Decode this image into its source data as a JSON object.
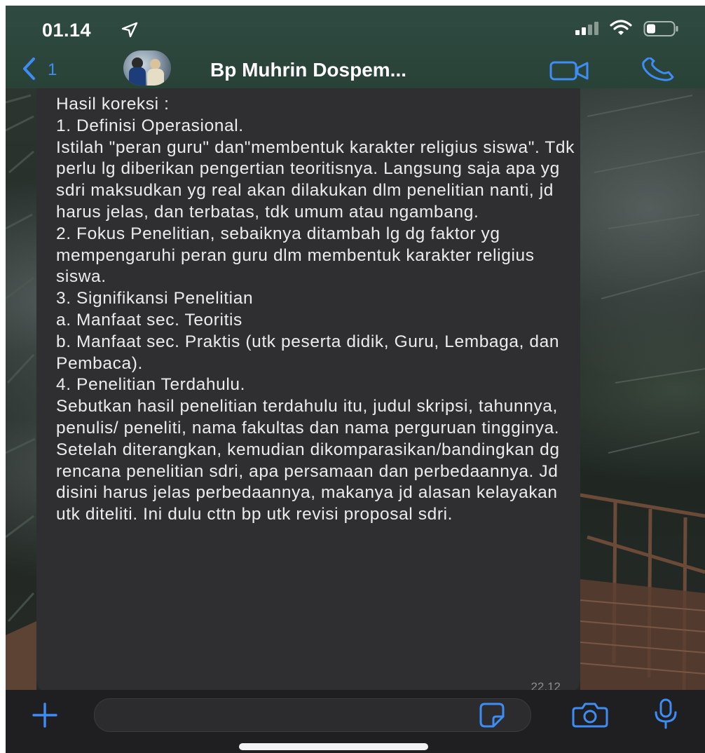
{
  "status_bar": {
    "time": "01.14",
    "icons": [
      "location-arrow-icon",
      "signal-icon",
      "wifi-icon",
      "battery-icon"
    ]
  },
  "nav": {
    "back_icon": "chevron-left-icon",
    "back_count": "1",
    "contact_name": "Bp Muhrin Dospem...",
    "video_icon": "video-camera-icon",
    "call_icon": "phone-icon"
  },
  "message": {
    "text": "Hasil koreksi :\n1. Definisi Operasional.\n   Istilah \"peran guru\" dan\"membentuk karakter religius siswa\". Tdk perlu lg diberikan pengertian teoritisnya. Langsung saja apa yg sdri maksudkan yg real akan dilakukan dlm penelitian nanti, jd harus jelas, dan terbatas, tdk umum atau ngambang.\n2. Fokus Penelitian, sebaiknya ditambah lg dg faktor yg mempengaruhi peran guru dlm membentuk karakter religius siswa.\n3. Signifikansi Penelitian\n     a. Manfaat sec. Teoritis\n      b. Manfaat sec. Praktis (utk peserta didik, Guru, Lembaga, dan Pembaca).\n4. Penelitian Terdahulu.\n   Sebutkan hasil penelitian terdahulu itu, judul skripsi, tahunnya, penulis/ peneliti, nama fakultas dan nama perguruan tingginya. Setelah diterangkan, kemudian dikomparasikan/bandingkan dg rencana penelitian sdri, apa persamaan dan perbedaannya. Jd disini harus jelas perbedaannya, makanya jd alasan kelayakan utk diteliti. Ini dulu cttn bp utk revisi proposal sdri.",
    "time": "22.12"
  },
  "input_bar": {
    "plus_icon": "plus-icon",
    "sticker_icon": "sticker-icon",
    "camera_icon": "camera-icon",
    "mic_icon": "microphone-icon"
  },
  "colors": {
    "accent": "#3d8df5",
    "header_bg": "#2f4b41",
    "bubble_bg": "#2f2f31",
    "input_bar_bg": "#1f1f21"
  }
}
